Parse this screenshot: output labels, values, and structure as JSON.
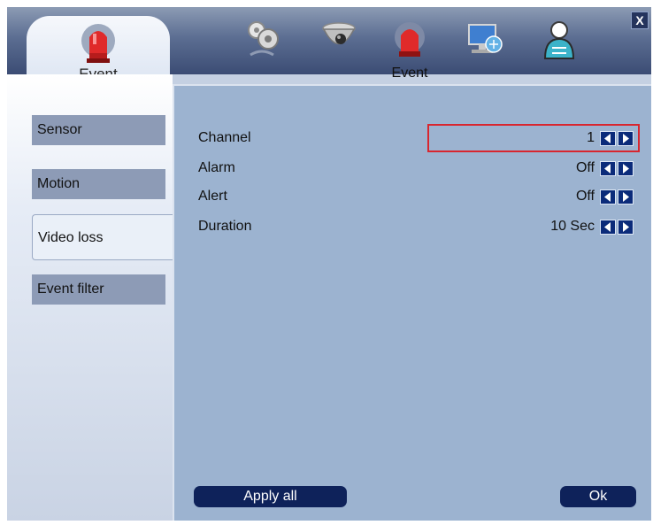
{
  "header": {
    "active_tab_label": "Event",
    "icons": [
      {
        "name": "settings-gears-icon",
        "label": ""
      },
      {
        "name": "camera-dome-icon",
        "label": ""
      },
      {
        "name": "event-alarm-icon",
        "label": "Event"
      },
      {
        "name": "network-icon",
        "label": ""
      },
      {
        "name": "user-icon",
        "label": ""
      }
    ],
    "close_label": "X"
  },
  "sidebar": {
    "items": [
      {
        "label": "Sensor",
        "active": false
      },
      {
        "label": "Motion",
        "active": false
      },
      {
        "label": "Video loss",
        "active": true
      },
      {
        "label": "Event filter",
        "active": false
      }
    ]
  },
  "form": {
    "rows": [
      {
        "label": "Channel",
        "value": "1"
      },
      {
        "label": "Alarm",
        "value": "Off"
      },
      {
        "label": "Alert",
        "value": "Off"
      },
      {
        "label": "Duration",
        "value": "10 Sec"
      }
    ]
  },
  "buttons": {
    "apply_all": "Apply all",
    "ok": "Ok"
  },
  "colors": {
    "accent_dark": "#0e225a",
    "highlight_border": "#d8262f",
    "panel_bg": "#9cb3d0"
  }
}
